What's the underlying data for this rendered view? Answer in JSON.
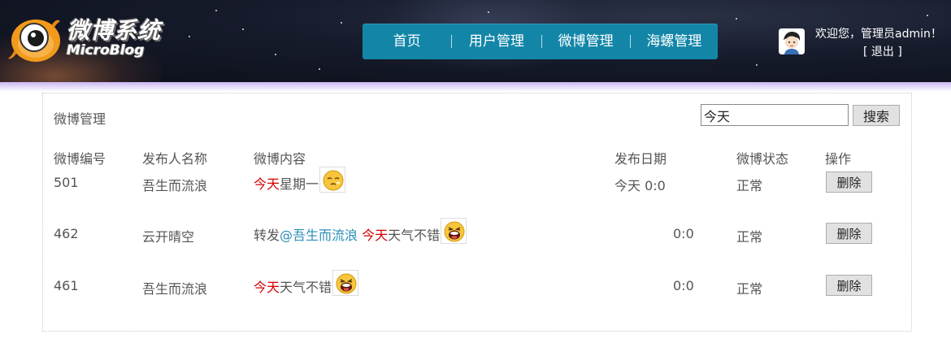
{
  "header": {
    "logo_title": "微博系统",
    "logo_subtitle": "MicroBlog",
    "nav": [
      {
        "label": "首页"
      },
      {
        "label": "用户管理"
      },
      {
        "label": "微博管理"
      },
      {
        "label": "海螺管理"
      }
    ],
    "welcome": "欢迎您，管理员admin！",
    "logout": "[ 退出 ]",
    "colors": {
      "nav_bg": "#1386a8",
      "header_bg": "#161b2b"
    }
  },
  "panel": {
    "title": "微博管理",
    "search": {
      "value": "今天",
      "button": "搜索"
    },
    "columns": [
      "微博编号",
      "发布人名称",
      "微博内容",
      "发布日期",
      "微博状态",
      "操作"
    ],
    "rows": [
      {
        "id": "501",
        "author": "吾生而流浪",
        "content": {
          "highlight": "今天",
          "rest": "星期一",
          "mention": "",
          "prefix": "",
          "emoji": "sleepy-face-icon"
        },
        "date": "今天 0:0",
        "status": "正常",
        "action": "删除"
      },
      {
        "id": "462",
        "author": "云开晴空",
        "content": {
          "prefix": "转发",
          "mention": "@吾生而流浪",
          "highlight": "今天",
          "rest": "天气不错",
          "emoji": "laughing-face-icon"
        },
        "date": "0:0",
        "status": "正常",
        "action": "删除"
      },
      {
        "id": "461",
        "author": "吾生而流浪",
        "content": {
          "prefix": "",
          "mention": "",
          "highlight": "今天",
          "rest": "天气不错",
          "emoji": "laughing-face-icon"
        },
        "date": "0:0",
        "status": "正常",
        "action": "删除"
      }
    ],
    "colors": {
      "highlight": "#d40000",
      "mention": "#2a8fb8"
    }
  }
}
